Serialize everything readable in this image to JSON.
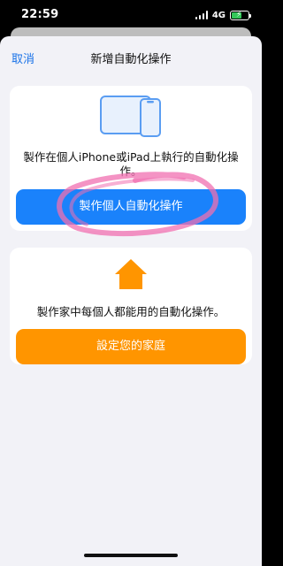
{
  "status_bar": {
    "time": "22:59",
    "network": "4G",
    "battery_color": "#34c759"
  },
  "nav": {
    "cancel_label": "取消",
    "title": "新增自動化操作"
  },
  "personal_card": {
    "icon": "iphone-ipad-devices-icon",
    "description": "製作在個人iPhone或iPad上執行的自動化操作。",
    "button_label": "製作個人自動化操作",
    "button_color": "#1a82fb"
  },
  "home_card": {
    "icon": "house-icon",
    "description": "製作家中每個人都能用的自動化操作。",
    "button_label": "設定您的家庭",
    "button_color": "#ff9500"
  },
  "colors": {
    "accent_link": "#1a73e8",
    "sheet_background": "#f2f2f7",
    "highlight_scribble": "#f06fb0"
  }
}
